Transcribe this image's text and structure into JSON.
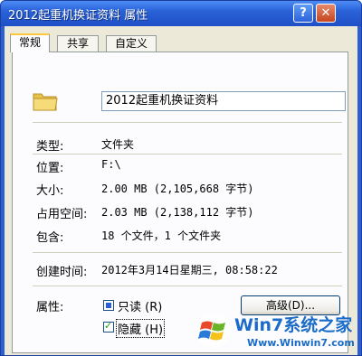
{
  "window": {
    "title": "2012起重机换证资料 属性",
    "help_label": "?",
    "close_label": "✕"
  },
  "tabs": [
    {
      "label": "常规",
      "active": true
    },
    {
      "label": "共享",
      "active": false
    },
    {
      "label": "自定义",
      "active": false
    }
  ],
  "general": {
    "folder_name": "2012起重机换证资料",
    "icon": "folder-icon",
    "type": {
      "label": "类型:",
      "value": "文件夹"
    },
    "location": {
      "label": "位置:",
      "value": "F:\\"
    },
    "size": {
      "label": "大小:",
      "value": "2.00 MB (2,105,668 字节)"
    },
    "size_on_disk": {
      "label": "占用空间:",
      "value": "2.03 MB (2,138,112 字节)"
    },
    "contains": {
      "label": "包含:",
      "value": "18 个文件，1 个文件夹"
    },
    "created": {
      "label": "创建时间:",
      "value": "2012年3月14日星期三, 08:58:22"
    },
    "attributes": {
      "label": "属性:",
      "readonly_label": "只读 (R)",
      "readonly_state": "indeterminate",
      "hidden_label": "隐藏 (H)",
      "hidden_checked": true,
      "advanced_button": "高级(D)..."
    }
  },
  "watermark": {
    "brand": "Win7系统之家",
    "url": "Www.Winwin7.com"
  },
  "colors": {
    "title_bar": "#2a62d8",
    "dialog_bg": "#ece9d8",
    "tab_highlight": "#ffc83c",
    "watermark": "#1a6cc8"
  }
}
